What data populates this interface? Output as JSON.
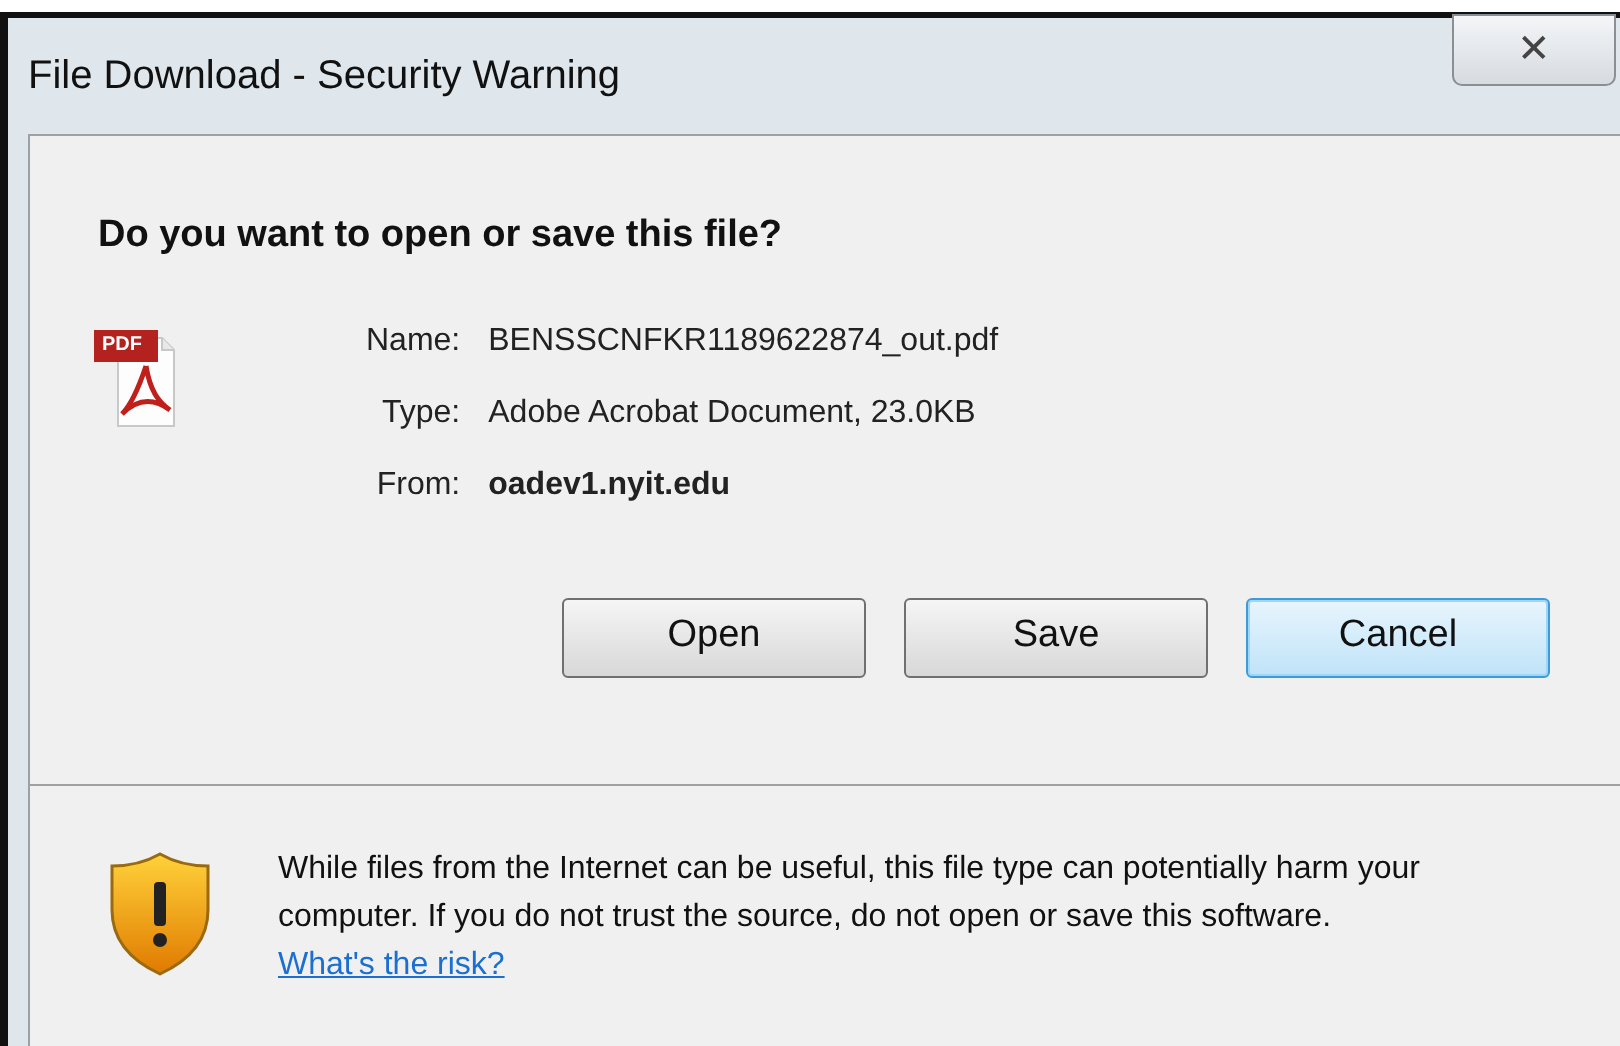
{
  "window": {
    "title": "File Download - Security Warning",
    "close_label": "✕"
  },
  "question": "Do you want to open or save this file?",
  "file_icon_label": "PDF",
  "fields": [
    {
      "label": "Name:",
      "value": "BENSSCNFKR1189622874_out.pdf",
      "bold": false
    },
    {
      "label": "Type:",
      "value": "Adobe Acrobat Document, 23.0KB",
      "bold": false
    },
    {
      "label": "From:",
      "value": "oadev1.nyit.edu",
      "bold": true
    }
  ],
  "buttons": [
    {
      "label": "Open",
      "default": false
    },
    {
      "label": "Save",
      "default": false
    },
    {
      "label": "Cancel",
      "default": true
    }
  ],
  "warning": {
    "text": "While files from the Internet can be useful, this file type can potentially harm your computer. If you do not trust the source, do not open or save this software.",
    "link": "What's the risk?"
  }
}
